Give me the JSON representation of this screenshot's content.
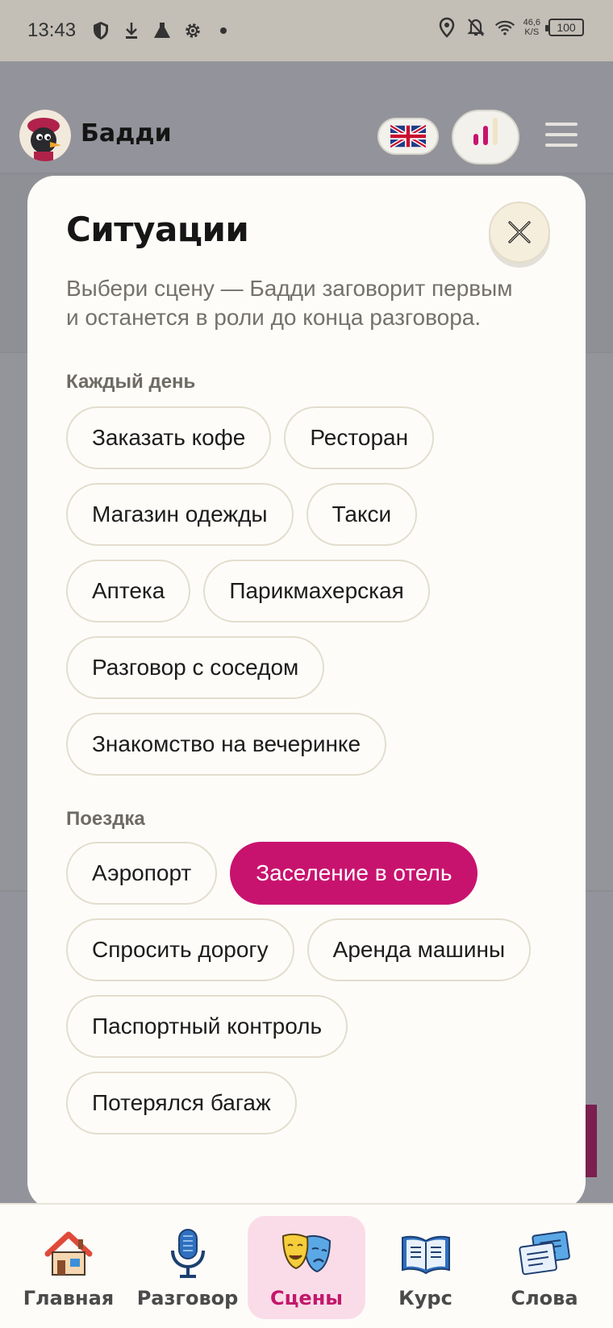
{
  "status_bar": {
    "time": "13:43",
    "net_speed_value": "46,6",
    "net_speed_unit": "K/S",
    "battery": "100"
  },
  "header": {
    "app_name": "Бадди"
  },
  "modal": {
    "title": "Ситуации",
    "subtitle": "Выбери сцену — Бадди заговорит первым и останется в роли до конца разговора.",
    "sections": [
      {
        "label": "Каждый день",
        "chips": [
          "Заказать кофе",
          "Ресторан",
          "Магазин одежды",
          "Такси",
          "Аптека",
          "Парикмахерская",
          "Разговор с соседом",
          "Знакомство на вечеринке"
        ]
      },
      {
        "label": "Поездка",
        "chips": [
          "Аэропорт",
          "Заселение в отель",
          "Спросить дорогу",
          "Аренда машины",
          "Паспортный контроль",
          "Потерялся багаж"
        ],
        "selected": "Заселение в отель"
      }
    ]
  },
  "bottom_nav": {
    "items": [
      {
        "label": "Главная",
        "icon": "house-icon"
      },
      {
        "label": "Разговор",
        "icon": "microphone-icon"
      },
      {
        "label": "Сцены",
        "icon": "theater-masks-icon",
        "active": true
      },
      {
        "label": "Курс",
        "icon": "open-book-icon"
      },
      {
        "label": "Слова",
        "icon": "cards-icon"
      }
    ]
  },
  "colors": {
    "accent": "#c8136e",
    "active_nav_bg": "#fadce8",
    "modal_bg": "#fdfcf9",
    "chip_border": "#e3ddcd"
  }
}
